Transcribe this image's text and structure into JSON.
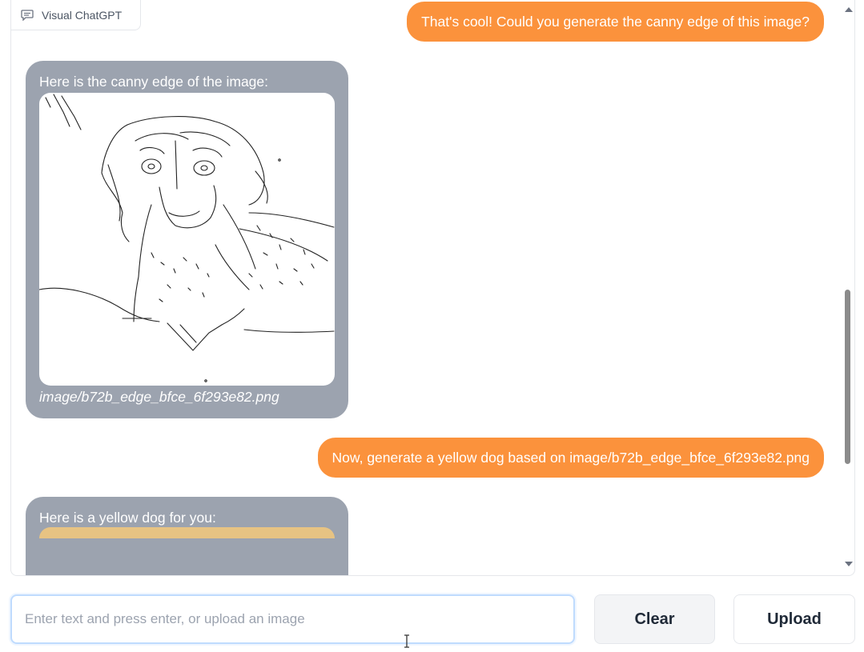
{
  "app": {
    "label": "Visual ChatGPT",
    "label_icon": "chat-bubble-icon"
  },
  "messages": [
    {
      "role": "user",
      "text": "That's cool! Could you generate the canny edge of this image?"
    },
    {
      "role": "bot",
      "text": "Here is the canny edge of the image:",
      "image_caption": "image/b72b_edge_bfce_6f293e82.png"
    },
    {
      "role": "user",
      "text": "Now, generate a yellow dog based on image/b72b_edge_bfce_6f293e82.png"
    },
    {
      "role": "bot",
      "text": "Here is a yellow dog for you:"
    }
  ],
  "input": {
    "placeholder": "Enter text and press enter, or upload an image",
    "value": ""
  },
  "buttons": {
    "clear": "Clear",
    "upload": "Upload"
  },
  "colors": {
    "user_bubble": "#fb923c",
    "bot_bubble": "#9ca3af",
    "input_focus": "#bfdbfe"
  }
}
